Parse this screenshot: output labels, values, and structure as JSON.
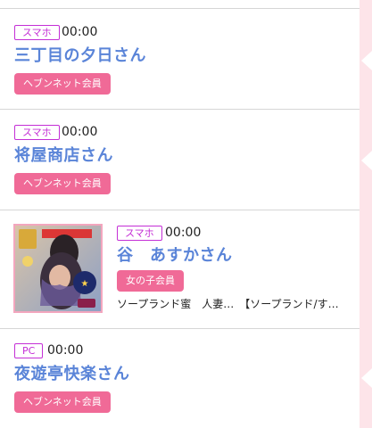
{
  "entries": [
    {
      "device": "スマホ",
      "time": "00:00",
      "name": "三丁目の夕日さん",
      "tag": "ヘブンネット会員"
    },
    {
      "device": "スマホ",
      "time": "00:00",
      "name": "将屋商店さん",
      "tag": "ヘブンネット会員"
    },
    {
      "device": "スマホ",
      "time": "00:00",
      "name": "谷　あすかさん",
      "tag": "女の子会員",
      "store": "ソープランド蜜　人妻…　【ソープランド/す…"
    },
    {
      "device": "PC",
      "time": "00:00",
      "name": "夜遊亭快楽さん",
      "tag": "ヘブンネット会員"
    }
  ],
  "thumbnail": {
    "icon": "profile-photo-image"
  },
  "colors": {
    "device_border": "#c42fd6",
    "name": "#5a84d8",
    "tag_bg": "#f06a97",
    "side_strip": "#fde4e9"
  }
}
